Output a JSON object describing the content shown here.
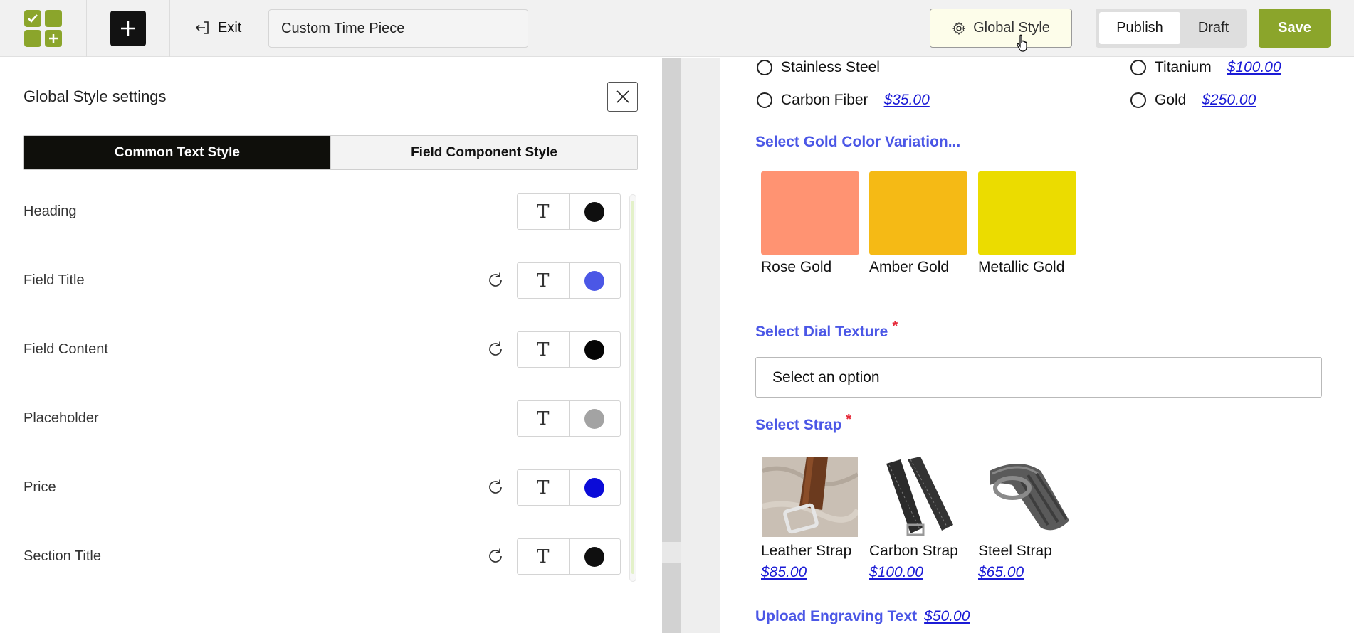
{
  "header": {
    "exit_label": "Exit",
    "form_title_value": "Custom Time Piece",
    "global_style_label": "Global Style",
    "publish_label": "Publish",
    "draft_label": "Draft",
    "save_label": "Save",
    "accent_color": "#8ba52b"
  },
  "panel": {
    "title": "Global Style settings",
    "tabs": [
      "Common Text Style",
      "Field Component Style"
    ],
    "active_tab": "Common Text Style",
    "rows": [
      {
        "label": "Heading",
        "has_reset": false,
        "color": "#0f0f0f"
      },
      {
        "label": "Field Title",
        "has_reset": true,
        "color": "#4b57e6"
      },
      {
        "label": "Field Content",
        "has_reset": true,
        "color": "#050505"
      },
      {
        "label": "Placeholder",
        "has_reset": false,
        "color": "#a3a3a3"
      },
      {
        "label": "Price",
        "has_reset": true,
        "color": "#0b0bd8"
      },
      {
        "label": "Section Title",
        "has_reset": true,
        "color": "#0f0f0f"
      }
    ],
    "text_button_glyph": "T"
  },
  "form": {
    "material_options": [
      {
        "label": "Stainless Steel",
        "price": ""
      },
      {
        "label": "Titanium",
        "price": "$100.00"
      },
      {
        "label": "Carbon Fiber",
        "price": "$35.00"
      },
      {
        "label": "Gold",
        "price": "$250.00"
      }
    ],
    "gold_color": {
      "title": "Select Gold Color Variation...",
      "options": [
        {
          "label": "Rose Gold",
          "color": "#ff9372"
        },
        {
          "label": "Amber Gold",
          "color": "#f5ba15"
        },
        {
          "label": "Metallic Gold",
          "color": "#ebdc00"
        }
      ]
    },
    "dial_texture": {
      "title": "Select Dial Texture",
      "required_mark": "*",
      "placeholder": "Select an option"
    },
    "strap": {
      "title": "Select Strap",
      "required_mark": "*",
      "options": [
        {
          "label": "Leather Strap",
          "price": "$85.00"
        },
        {
          "label": "Carbon Strap",
          "price": "$100.00"
        },
        {
          "label": "Steel Strap",
          "price": "$65.00"
        }
      ]
    },
    "engraving": {
      "title": "Upload Engraving Text",
      "price": "$50.00"
    }
  }
}
